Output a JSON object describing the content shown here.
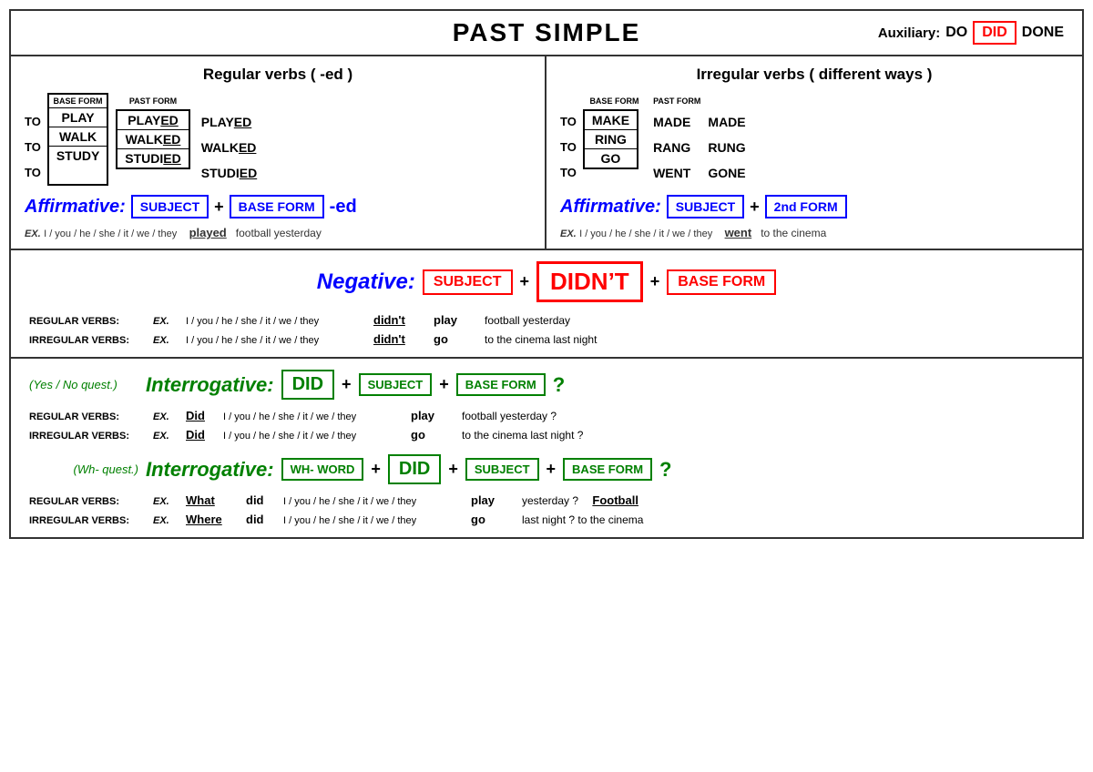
{
  "header": {
    "title": "PAST SIMPLE",
    "auxiliary_label": "Auxiliary:",
    "aux_do": "DO",
    "aux_did": "DID",
    "aux_done": "DONE"
  },
  "left_panel": {
    "title": "Regular verbs  ( -ed )",
    "base_form_label": "BASE FORM",
    "past_form_label": "PAST FORM",
    "to_labels": [
      "TO",
      "TO",
      "TO"
    ],
    "base_verbs": [
      "PLAY",
      "WALK",
      "STUDY"
    ],
    "past_boxed": [
      "PLAYED",
      "WALKED",
      "STUDIED"
    ],
    "past_unboxed": [
      "PLAYED",
      "WALKED",
      "STUDIED"
    ],
    "affirmative_label": "Affirmative:",
    "subject_box": "SUBJECT",
    "base_form_box": "BASE FORM",
    "suffix": "-ed",
    "example_label": "EX.",
    "example_subject": "I / you / he / she / it / we / they",
    "example_verb": "played",
    "example_rest": "football yesterday"
  },
  "right_panel": {
    "title": "Irregular verbs  ( different ways )",
    "base_form_label": "BASE FORM",
    "past_form_label": "PAST FORM",
    "to_labels": [
      "TO",
      "TO",
      "TO"
    ],
    "base_verbs": [
      "MAKE",
      "RING",
      "GO"
    ],
    "past_forms": [
      "MADE",
      "RANG",
      "WENT"
    ],
    "pp_forms": [
      "MADE",
      "RUNG",
      "GONE"
    ],
    "affirmative_label": "Affirmative:",
    "subject_box": "SUBJECT",
    "nd_form_box": "2nd FORM",
    "example_label": "EX.",
    "example_subject": "I / you / he / she / it / we / they",
    "example_verb": "went",
    "example_rest": "to the cinema"
  },
  "negative": {
    "label": "Negative:",
    "subject_box": "SUBJECT",
    "didnt_box": "DIDN’T",
    "base_form_box": "BASE FORM",
    "regular_label": "REGULAR VERBS:",
    "irregular_label": "IRREGULAR VERBS:",
    "ex_label": "EX.",
    "subject_text": "I / you / he / she / it / we / they",
    "reg_didnt": "didn't",
    "reg_verb": "play",
    "reg_rest": "football yesterday",
    "irr_didnt": "didn't",
    "irr_verb": "go",
    "irr_rest": "to the cinema last night"
  },
  "interrogative_yes_no": {
    "yes_no_label": "(Yes / No quest.)",
    "int_label": "Interrogative:",
    "did_box": "DID",
    "subject_box": "SUBJECT",
    "base_form_box": "BASE FORM",
    "question_mark": "?",
    "regular_label": "REGULAR VERBS:",
    "irregular_label": "IRREGULAR VERBS:",
    "ex_label": "EX.",
    "subject_text": "I / you / he / she / it / we / they",
    "reg_did": "Did",
    "reg_verb": "play",
    "reg_rest": "football yesterday ?",
    "irr_did": "Did",
    "irr_verb": "go",
    "irr_rest": "to the cinema last night ?"
  },
  "interrogative_wh": {
    "wh_label": "(Wh- quest.)",
    "int_label": "Interrogative:",
    "wh_word_box": "WH- WORD",
    "did_box": "DID",
    "subject_box": "SUBJECT",
    "base_form_box": "BASE FORM",
    "question_mark": "?",
    "regular_label": "REGULAR VERBS:",
    "irregular_label": "IRREGULAR VERBS:",
    "ex_label": "EX.",
    "subject_text": "I / you / he / she / it / we / they",
    "reg_wh_word": "What",
    "reg_did": "did",
    "reg_verb": "play",
    "reg_rest": "yesterday ?",
    "reg_football": "Football",
    "irr_wh_word": "Where",
    "irr_did": "did",
    "irr_verb": "go",
    "irr_rest": "last night ?  to the cinema"
  }
}
